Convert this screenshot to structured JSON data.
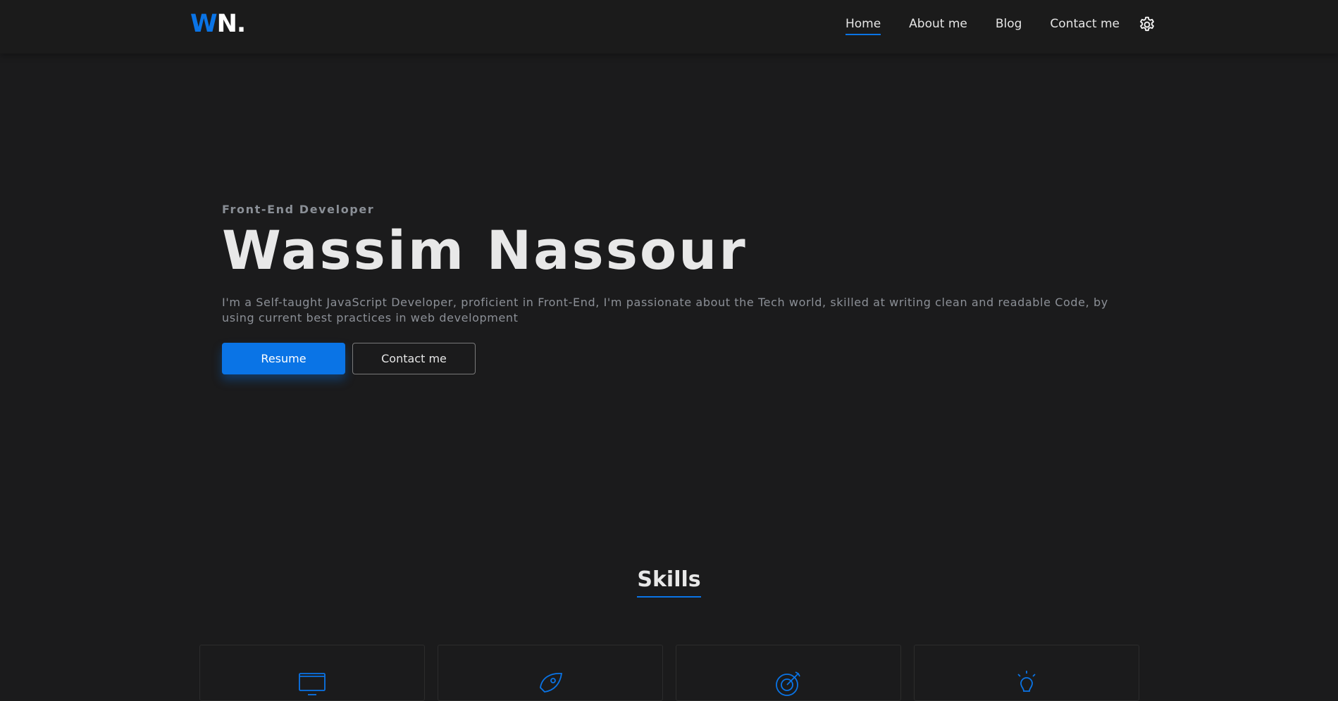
{
  "navbar": {
    "logo": {
      "w": "W",
      "n": "N."
    },
    "links": [
      {
        "label": "Home",
        "active": true
      },
      {
        "label": "About me",
        "active": false
      },
      {
        "label": "Blog",
        "active": false
      },
      {
        "label": "Contact me",
        "active": false
      }
    ],
    "settings_icon": "gear-icon"
  },
  "hero": {
    "subtitle": "Front-End Developer",
    "title": "Wassim Nassour",
    "description": "I'm a Self-taught JavaScript Developer, proficient in Front-End, I'm passionate about the Tech world, skilled at writing clean and readable Code, by using current best practices in web development",
    "buttons": {
      "resume": "Resume",
      "contact": "Contact me"
    }
  },
  "skills": {
    "heading": "Skills",
    "cards": [
      {
        "icon": "monitor-icon"
      },
      {
        "icon": "rocket-icon"
      },
      {
        "icon": "target-icon"
      },
      {
        "icon": "lightbulb-icon"
      }
    ]
  },
  "colors": {
    "accent": "#0a74e6",
    "background": "#1b1b1c"
  }
}
